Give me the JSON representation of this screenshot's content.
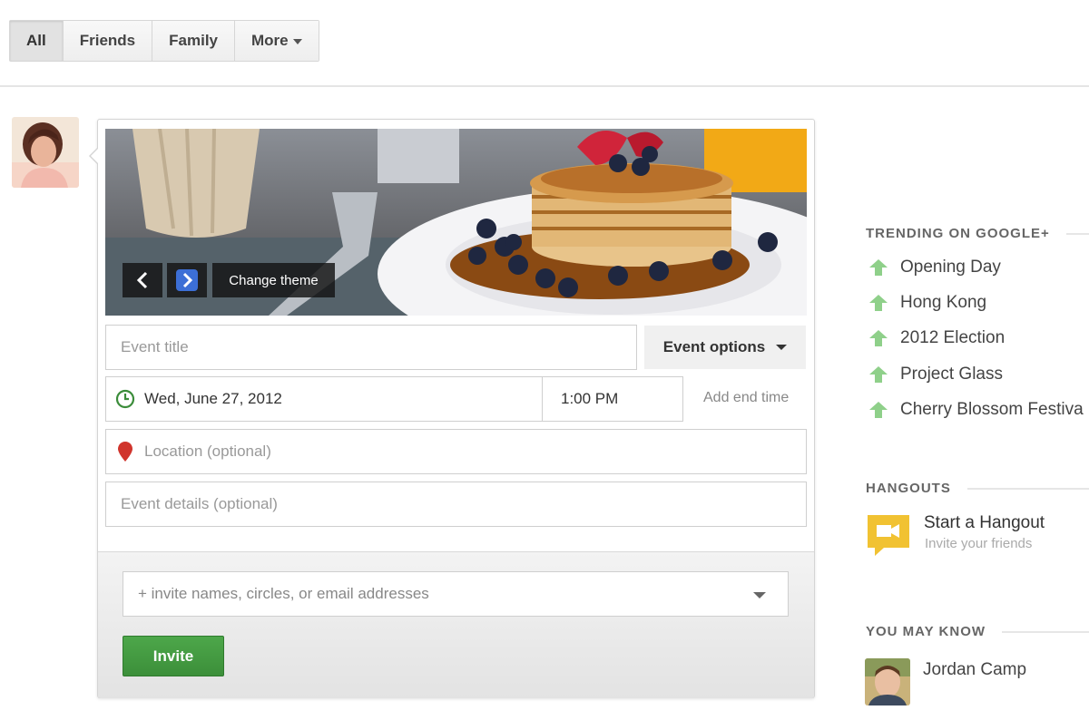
{
  "filters": {
    "all": "All",
    "friends": "Friends",
    "family": "Family",
    "more": "More"
  },
  "event_form": {
    "change_theme": "Change theme",
    "title_placeholder": "Event title",
    "event_options": "Event options",
    "date": "Wed, June 27, 2012",
    "time": "1:00 PM",
    "add_end_time": "Add end time",
    "location_placeholder": "Location (optional)",
    "details_placeholder": "Event details (optional)",
    "invite_placeholder": "+ invite names, circles, or email addresses",
    "invite_button": "Invite"
  },
  "sidebar": {
    "trending_heading": "TRENDING ON GOOGLE+",
    "trending": [
      "Opening Day",
      "Hong Kong",
      "2012 Election",
      "Project Glass",
      "Cherry Blossom Festiva"
    ],
    "hangouts_heading": "HANGOUTS",
    "hangout_title": "Start a Hangout",
    "hangout_sub": "Invite your friends",
    "know_heading": "YOU MAY KNOW",
    "person_name": "Jordan Camp"
  },
  "colors": {
    "invite_green": "#3f9a3d",
    "trend_arrow": "#8fd08a",
    "hangout_yellow": "#f1c232",
    "clock_green": "#3b8c3a",
    "pin_red": "#d0342c",
    "next_blue": "#3c6fd6"
  }
}
